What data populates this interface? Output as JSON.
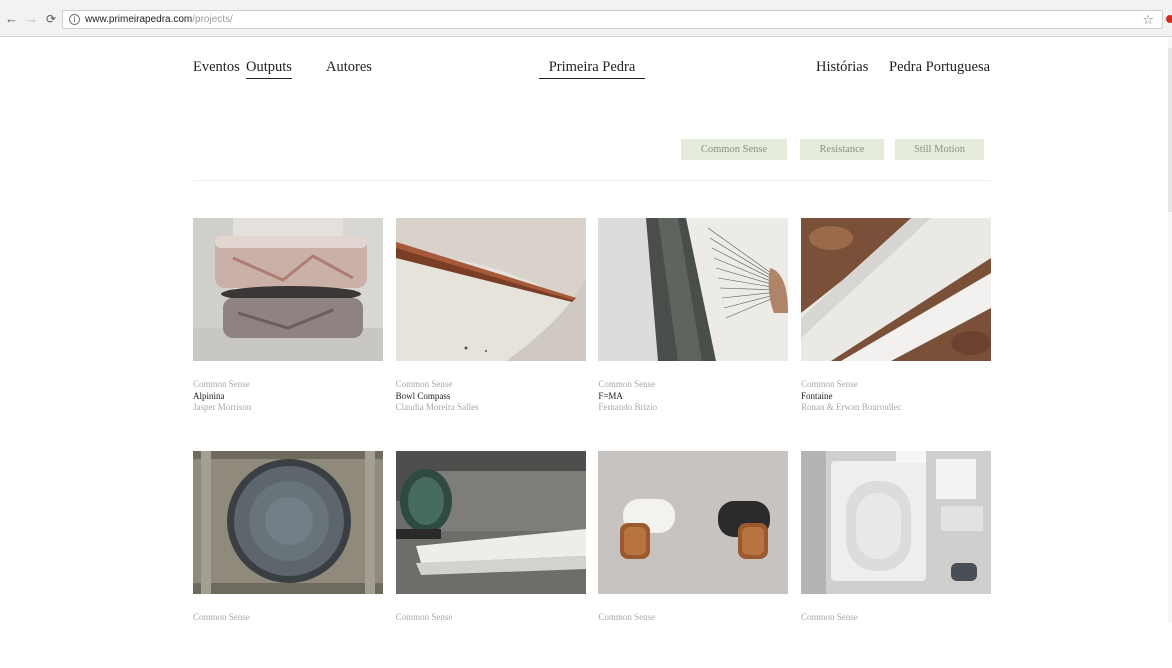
{
  "browser": {
    "back_icon": "arrow-left-icon",
    "forward_icon": "arrow-right-icon",
    "reload_icon": "reload-icon",
    "url_host": "www.primeirapedra.com",
    "url_path": "/projects/",
    "bookmark_icon": "star-icon"
  },
  "nav": {
    "eventos": "Eventos",
    "outputs": "Outputs",
    "autores": "Autores",
    "brand": "Primeira Pedra",
    "historias": "Histórias",
    "pedra_portuguesa": "Pedra Portuguesa"
  },
  "filters": {
    "common_sense": "Common Sense",
    "resistance": "Resistance",
    "still_motion": "Still Motion"
  },
  "projects": [
    {
      "category": "Common Sense",
      "title": "Alpinina",
      "author": "Jasper Morrison"
    },
    {
      "category": "Common Sense",
      "title": "Bowl Compass",
      "author": "Claudia Moreira Salles"
    },
    {
      "category": "Common Sense",
      "title": "F=MA",
      "author": "Fernando Brizio"
    },
    {
      "category": "Common Sense",
      "title": "Fontaine",
      "author": "Ronan & Erwan Bouroullec"
    },
    {
      "category": "Common Sense",
      "title": "",
      "author": ""
    },
    {
      "category": "Common Sense",
      "title": "",
      "author": ""
    },
    {
      "category": "Common Sense",
      "title": "",
      "author": ""
    },
    {
      "category": "Common Sense",
      "title": "",
      "author": ""
    }
  ]
}
